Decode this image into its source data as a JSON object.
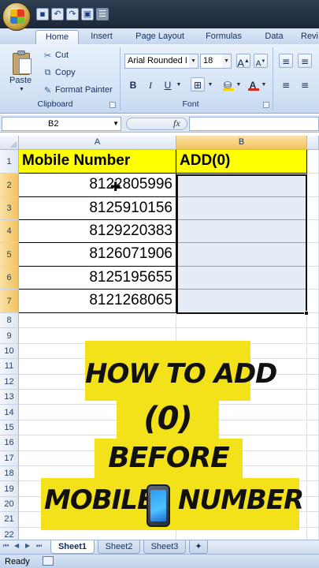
{
  "app": {
    "name": "Microsoft Excel"
  },
  "quick_access": {
    "icons": [
      "save-icon",
      "undo-icon",
      "redo-icon",
      "customize-icon"
    ]
  },
  "ribbon": {
    "tabs": [
      "Home",
      "Insert",
      "Page Layout",
      "Formulas",
      "Data",
      "Revi"
    ],
    "active_tab": "Home",
    "clipboard": {
      "paste": "Paste",
      "cut": "Cut",
      "copy": "Copy",
      "format_painter": "Format Painter",
      "label": "Clipboard"
    },
    "font": {
      "name": "Arial Rounded I",
      "size": "18",
      "bold": "B",
      "italic": "I",
      "underline": "U",
      "label": "Font",
      "font_color": "#d42b1e",
      "fill_color": "#f6d200"
    }
  },
  "formula_bar": {
    "name_box": "B2",
    "fx": "fx",
    "value": ""
  },
  "grid": {
    "columns": [
      "A",
      "B"
    ],
    "rows": [
      "1",
      "2",
      "3",
      "4",
      "5",
      "6",
      "7",
      "8",
      "9",
      "10",
      "11",
      "12",
      "13",
      "14",
      "15",
      "16",
      "17",
      "18",
      "19",
      "20",
      "21",
      "22"
    ],
    "header": {
      "a": "Mobile Number",
      "b": "ADD(0)"
    },
    "numbers": [
      "8122805996",
      "8125910156",
      "8129220383",
      "8126071906",
      "8125195655",
      "8121268065"
    ],
    "selection": "B2:B7"
  },
  "overlay": {
    "line1": "HOW TO ADD",
    "line2": "(0)",
    "line3": "BEFORE",
    "line4_left": "MOBILE",
    "line4_right": "NUMBER",
    "icon": "mobile-phone-icon",
    "color": "#f3e21a"
  },
  "sheets": {
    "tabs": [
      "Sheet1",
      "Sheet2",
      "Sheet3"
    ],
    "active": "Sheet1"
  },
  "status": {
    "text": "Ready"
  }
}
